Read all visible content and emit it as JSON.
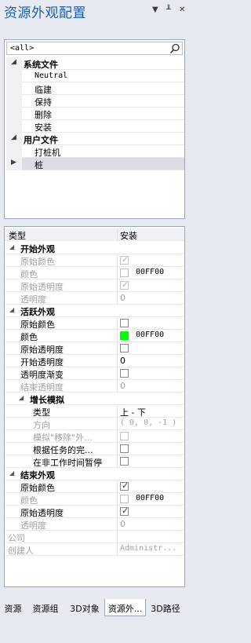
{
  "window": {
    "title": "资源外观配置",
    "controls": [
      "▼",
      "╨",
      "✕"
    ]
  },
  "tree": {
    "filter_value": "<all>",
    "rows": [
      {
        "label": "系统文件",
        "kind": "group",
        "arrow": "◢"
      },
      {
        "label": "Neutral",
        "kind": "item",
        "mono": true
      },
      {
        "label": "临建",
        "kind": "item"
      },
      {
        "label": "保持",
        "kind": "item"
      },
      {
        "label": "删除",
        "kind": "item"
      },
      {
        "label": "安装",
        "kind": "item"
      },
      {
        "label": "用户文件",
        "kind": "group",
        "arrow": "◢"
      },
      {
        "label": "打桩机",
        "kind": "item"
      },
      {
        "label": "桩",
        "kind": "item",
        "selected": true,
        "arrow": "▶"
      }
    ]
  },
  "grid": {
    "header_name": "类型",
    "header_value": "安装",
    "rows": [
      {
        "name": "开始外观",
        "type": "cat",
        "caret": "◢",
        "level": 0
      },
      {
        "name": "原始颜色",
        "type": "prop",
        "disabled": true,
        "check": true
      },
      {
        "name": "颜色",
        "type": "prop",
        "disabled": true,
        "color": "#ffffff",
        "value": "00FF00"
      },
      {
        "name": "原始透明度",
        "type": "prop",
        "disabled": true,
        "check": true
      },
      {
        "name": "透明度",
        "type": "prop",
        "disabled": true,
        "value": "0"
      },
      {
        "name": "活跃外观",
        "type": "cat",
        "caret": "◢",
        "level": 0
      },
      {
        "name": "原始颜色",
        "type": "prop",
        "check": false
      },
      {
        "name": "颜色",
        "type": "prop",
        "color": "#00ff00",
        "value": "00FF00"
      },
      {
        "name": "原始透明度",
        "type": "prop",
        "check": false
      },
      {
        "name": "开始透明度",
        "type": "prop",
        "value": "0"
      },
      {
        "name": "透明度渐变",
        "type": "prop",
        "check": false
      },
      {
        "name": "结束透明度",
        "type": "prop",
        "disabled": true,
        "value": "0"
      },
      {
        "name": "增长模拟",
        "type": "cat",
        "caret": "◢",
        "level": 1
      },
      {
        "name": "类型",
        "type": "prop",
        "level": 1,
        "value": "上 - 下"
      },
      {
        "name": "方向",
        "type": "prop",
        "level": 1,
        "disabled": true,
        "value": "( 0, 0, -1 )",
        "mono": true
      },
      {
        "name": "模拟\"移除\"外...",
        "type": "prop",
        "level": 1,
        "disabled": true,
        "check": false
      },
      {
        "name": "根据任务的完...",
        "type": "prop",
        "level": 1,
        "check": false
      },
      {
        "name": "在非工作时间暂停",
        "type": "prop",
        "level": 1,
        "check": false
      },
      {
        "name": "结束外观",
        "type": "cat",
        "caret": "◢",
        "level": 0
      },
      {
        "name": "原始颜色",
        "type": "prop",
        "check": true
      },
      {
        "name": "颜色",
        "type": "prop",
        "disabled": true,
        "color": "#ffffff",
        "value": "00FF00"
      },
      {
        "name": "原始透明度",
        "type": "prop",
        "check": true
      },
      {
        "name": "透明度",
        "type": "prop",
        "disabled": true,
        "value": "0"
      },
      {
        "name": "公司",
        "type": "root",
        "disabled": true,
        "value": ""
      },
      {
        "name": "创建人",
        "type": "root",
        "disabled": true,
        "value": "Administr...",
        "mono": true
      }
    ]
  },
  "tabs": [
    {
      "label": "资源",
      "active": false
    },
    {
      "label": "资源组",
      "active": false
    },
    {
      "label": "3D对象",
      "active": false
    },
    {
      "label": "资源外...",
      "active": true
    },
    {
      "label": "3D路径",
      "active": false
    }
  ],
  "colors": {
    "accent": "#1e5ea8",
    "active_color_swatch": "#00ff00"
  }
}
